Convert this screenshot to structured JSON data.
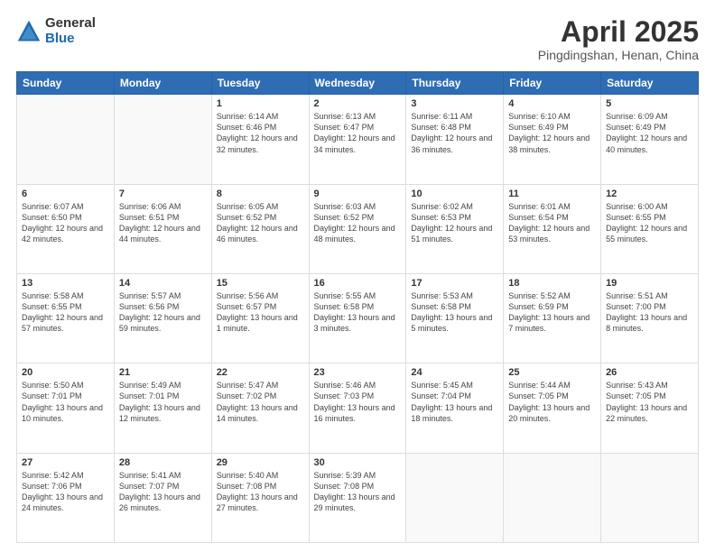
{
  "logo": {
    "general": "General",
    "blue": "Blue"
  },
  "title": "April 2025",
  "subtitle": "Pingdingshan, Henan, China",
  "days_of_week": [
    "Sunday",
    "Monday",
    "Tuesday",
    "Wednesday",
    "Thursday",
    "Friday",
    "Saturday"
  ],
  "weeks": [
    [
      {
        "day": "",
        "info": ""
      },
      {
        "day": "",
        "info": ""
      },
      {
        "day": "1",
        "info": "Sunrise: 6:14 AM\nSunset: 6:46 PM\nDaylight: 12 hours\nand 32 minutes."
      },
      {
        "day": "2",
        "info": "Sunrise: 6:13 AM\nSunset: 6:47 PM\nDaylight: 12 hours\nand 34 minutes."
      },
      {
        "day": "3",
        "info": "Sunrise: 6:11 AM\nSunset: 6:48 PM\nDaylight: 12 hours\nand 36 minutes."
      },
      {
        "day": "4",
        "info": "Sunrise: 6:10 AM\nSunset: 6:49 PM\nDaylight: 12 hours\nand 38 minutes."
      },
      {
        "day": "5",
        "info": "Sunrise: 6:09 AM\nSunset: 6:49 PM\nDaylight: 12 hours\nand 40 minutes."
      }
    ],
    [
      {
        "day": "6",
        "info": "Sunrise: 6:07 AM\nSunset: 6:50 PM\nDaylight: 12 hours\nand 42 minutes."
      },
      {
        "day": "7",
        "info": "Sunrise: 6:06 AM\nSunset: 6:51 PM\nDaylight: 12 hours\nand 44 minutes."
      },
      {
        "day": "8",
        "info": "Sunrise: 6:05 AM\nSunset: 6:52 PM\nDaylight: 12 hours\nand 46 minutes."
      },
      {
        "day": "9",
        "info": "Sunrise: 6:03 AM\nSunset: 6:52 PM\nDaylight: 12 hours\nand 48 minutes."
      },
      {
        "day": "10",
        "info": "Sunrise: 6:02 AM\nSunset: 6:53 PM\nDaylight: 12 hours\nand 51 minutes."
      },
      {
        "day": "11",
        "info": "Sunrise: 6:01 AM\nSunset: 6:54 PM\nDaylight: 12 hours\nand 53 minutes."
      },
      {
        "day": "12",
        "info": "Sunrise: 6:00 AM\nSunset: 6:55 PM\nDaylight: 12 hours\nand 55 minutes."
      }
    ],
    [
      {
        "day": "13",
        "info": "Sunrise: 5:58 AM\nSunset: 6:55 PM\nDaylight: 12 hours\nand 57 minutes."
      },
      {
        "day": "14",
        "info": "Sunrise: 5:57 AM\nSunset: 6:56 PM\nDaylight: 12 hours\nand 59 minutes."
      },
      {
        "day": "15",
        "info": "Sunrise: 5:56 AM\nSunset: 6:57 PM\nDaylight: 13 hours\nand 1 minute."
      },
      {
        "day": "16",
        "info": "Sunrise: 5:55 AM\nSunset: 6:58 PM\nDaylight: 13 hours\nand 3 minutes."
      },
      {
        "day": "17",
        "info": "Sunrise: 5:53 AM\nSunset: 6:58 PM\nDaylight: 13 hours\nand 5 minutes."
      },
      {
        "day": "18",
        "info": "Sunrise: 5:52 AM\nSunset: 6:59 PM\nDaylight: 13 hours\nand 7 minutes."
      },
      {
        "day": "19",
        "info": "Sunrise: 5:51 AM\nSunset: 7:00 PM\nDaylight: 13 hours\nand 8 minutes."
      }
    ],
    [
      {
        "day": "20",
        "info": "Sunrise: 5:50 AM\nSunset: 7:01 PM\nDaylight: 13 hours\nand 10 minutes."
      },
      {
        "day": "21",
        "info": "Sunrise: 5:49 AM\nSunset: 7:01 PM\nDaylight: 13 hours\nand 12 minutes."
      },
      {
        "day": "22",
        "info": "Sunrise: 5:47 AM\nSunset: 7:02 PM\nDaylight: 13 hours\nand 14 minutes."
      },
      {
        "day": "23",
        "info": "Sunrise: 5:46 AM\nSunset: 7:03 PM\nDaylight: 13 hours\nand 16 minutes."
      },
      {
        "day": "24",
        "info": "Sunrise: 5:45 AM\nSunset: 7:04 PM\nDaylight: 13 hours\nand 18 minutes."
      },
      {
        "day": "25",
        "info": "Sunrise: 5:44 AM\nSunset: 7:05 PM\nDaylight: 13 hours\nand 20 minutes."
      },
      {
        "day": "26",
        "info": "Sunrise: 5:43 AM\nSunset: 7:05 PM\nDaylight: 13 hours\nand 22 minutes."
      }
    ],
    [
      {
        "day": "27",
        "info": "Sunrise: 5:42 AM\nSunset: 7:06 PM\nDaylight: 13 hours\nand 24 minutes."
      },
      {
        "day": "28",
        "info": "Sunrise: 5:41 AM\nSunset: 7:07 PM\nDaylight: 13 hours\nand 26 minutes."
      },
      {
        "day": "29",
        "info": "Sunrise: 5:40 AM\nSunset: 7:08 PM\nDaylight: 13 hours\nand 27 minutes."
      },
      {
        "day": "30",
        "info": "Sunrise: 5:39 AM\nSunset: 7:08 PM\nDaylight: 13 hours\nand 29 minutes."
      },
      {
        "day": "",
        "info": ""
      },
      {
        "day": "",
        "info": ""
      },
      {
        "day": "",
        "info": ""
      }
    ]
  ]
}
